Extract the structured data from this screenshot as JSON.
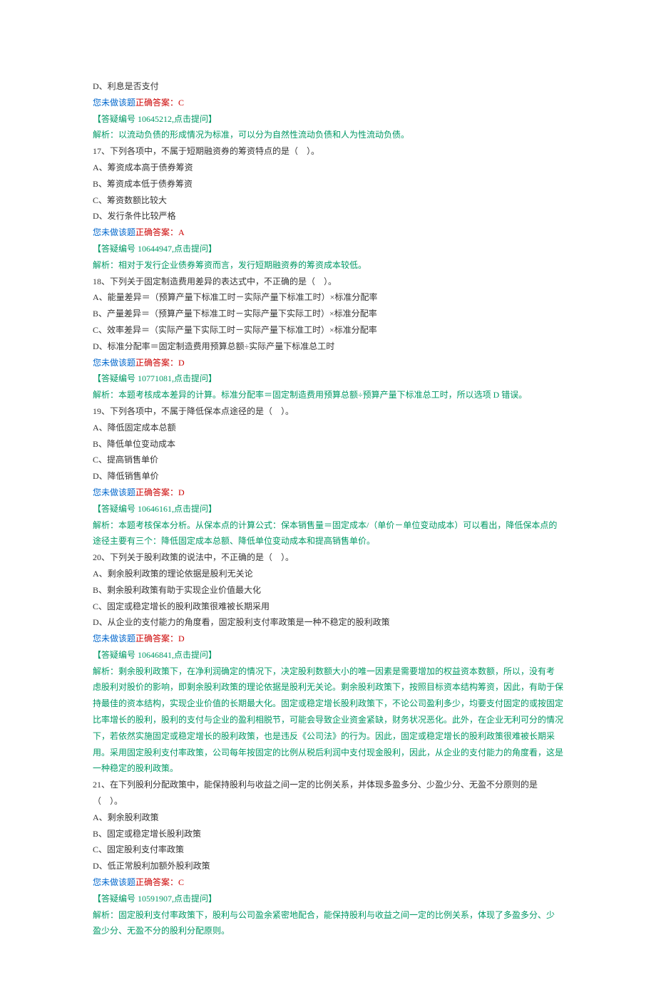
{
  "pre16": {
    "optD": "D、利息是否支付",
    "not_done": "您未做该题",
    "correct": "正确答案：C",
    "ref": "【答疑编号 10645212,点击提问】",
    "explain_label": "解析：",
    "explain": "以流动负债的形成情况为标准，可以分为自然性流动负债和人为性流动负债。"
  },
  "q17": {
    "stem": "17、下列各项中，不属于短期融资券的筹资特点的是（　）。",
    "optA": "A、筹资成本高于债券筹资",
    "optB": "B、筹资成本低于债券筹资",
    "optC": "C、筹资数额比较大",
    "optD": "D、发行条件比较严格",
    "not_done": "您未做该题",
    "correct": "正确答案：A",
    "ref": "【答疑编号 10644947,点击提问】",
    "explain_label": "解析：",
    "explain": "相对于发行企业债券筹资而言，发行短期融资券的筹资成本较低。"
  },
  "q18": {
    "stem": "18、下列关于固定制造费用差异的表达式中，不正确的是（　）。",
    "optA": "A、能量差异＝（预算产量下标准工时－实际产量下标准工时）×标准分配率",
    "optB": "B、产量差异＝（预算产量下标准工时－实际产量下实际工时）×标准分配率",
    "optC": "C、效率差异＝（实际产量下实际工时－实际产量下标准工时）×标准分配率",
    "optD": "D、标准分配率＝固定制造费用预算总额÷实际产量下标准总工时",
    "not_done": "您未做该题",
    "correct": "正确答案：D",
    "ref": "【答疑编号 10771081,点击提问】",
    "explain_label": "解析：",
    "explain": "本题考核成本差异的计算。标准分配率＝固定制造费用预算总额÷预算产量下标准总工时，所以选项 D 错误。"
  },
  "q19": {
    "stem": "19、下列各项中，不属于降低保本点途径的是（　）。",
    "optA": "A、降低固定成本总额",
    "optB": "B、降低单位变动成本",
    "optC": "C、提高销售单价",
    "optD": "D、降低销售单价",
    "not_done": "您未做该题",
    "correct": "正确答案：D",
    "ref": "【答疑编号 10646161,点击提问】",
    "explain_label": "解析：",
    "explain": "本题考核保本分析。从保本点的计算公式：保本销售量＝固定成本/（单价－单位变动成本）可以看出，降低保本点的途径主要有三个：降低固定成本总额、降低单位变动成本和提高销售单价。"
  },
  "q20": {
    "stem": "20、下列关于股利政策的说法中，不正确的是（　）。",
    "optA": "A、剩余股利政策的理论依据是股利无关论",
    "optB": "B、剩余股利政策有助于实现企业价值最大化",
    "optC": "C、固定或稳定增长的股利政策很难被长期采用",
    "optD": "D、从企业的支付能力的角度看，固定股利支付率政策是一种不稳定的股利政策",
    "not_done": "您未做该题",
    "correct": "正确答案：D",
    "ref": "【答疑编号 10646841,点击提问】",
    "explain_label": "解析：",
    "explain": "剩余股利政策下，在净利润确定的情况下，决定股利数额大小的唯一因素是需要增加的权益资本数额，所以，没有考虑股利对股价的影响，即剩余股利政策的理论依据是股利无关论。剩余股利政策下，按照目标资本结构筹资，因此，有助于保持最佳的资本结构，实现企业价值的长期最大化。固定或稳定增长股利政策下，不论公司盈利多少，均要支付固定的或按固定比率增长的股利，股利的支付与企业的盈利相脱节，可能会导致企业资金紧缺，财务状况恶化。此外，在企业无利可分的情况下，若依然实施固定或稳定增长的股利政策，也是违反《公司法》的行为。因此，固定或稳定增长的股利政策很难被长期采用。采用固定股利支付率政策，公司每年按固定的比例从税后利润中支付现金股利，因此，从企业的支付能力的角度看，这是一种稳定的股利政策。"
  },
  "q21": {
    "stem": "21、在下列股利分配政策中，能保持股利与收益之间一定的比例关系，并体现多盈多分、少盈少分、无盈不分原则的是（　）。",
    "optA": "A、剩余股利政策",
    "optB": "B、固定或稳定增长股利政策",
    "optC": "C、固定股利支付率政策",
    "optD": "D、低正常股利加额外股利政策",
    "not_done": "您未做该题",
    "correct": "正确答案：C",
    "ref": "【答疑编号 10591907,点击提问】",
    "explain_label": "解析：",
    "explain": "固定股利支付率政策下，股利与公司盈余紧密地配合，能保持股利与收益之间一定的比例关系，体现了多盈多分、少盈少分、无盈不分的股利分配原则。"
  }
}
